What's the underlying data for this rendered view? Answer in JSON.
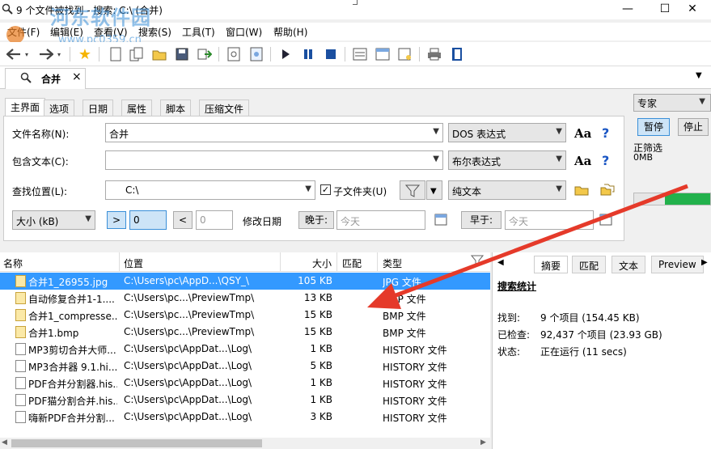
{
  "window": {
    "title": "9 个文件被找到 - 搜索: C:\\ (合并)",
    "min": "—",
    "restore": "☐",
    "close": "✕"
  },
  "watermark": {
    "line1": "河东软件园",
    "line2": "www.pc0359.cn"
  },
  "menu": [
    "文件(F)",
    "编辑(E)",
    "查看(V)",
    "搜索(S)",
    "工具(T)",
    "窗口(W)",
    "帮助(H)"
  ],
  "search_tab": {
    "label": "合并",
    "close": "×"
  },
  "panel_tabs": [
    "主界面",
    "选项",
    "日期",
    "属性",
    "脚本",
    "压缩文件"
  ],
  "form": {
    "filename_label": "文件名称(N):",
    "filename_value": "合并",
    "filename_mode": "DOS 表达式",
    "contains_label": "包含文本(C):",
    "contains_value": "",
    "contains_mode": "布尔表达式",
    "location_label": "查找位置(L):",
    "location_value": "C:\\",
    "subfolders_label": "子文件夹(U)",
    "subfolders_checked": true,
    "location_mode": "纯文本",
    "size_label": "大小 (kB)",
    "gt": ">",
    "gt_value": "0",
    "lt": "<",
    "lt_value": "0",
    "mod_date_label": "修改日期",
    "later_btn": "晚于:",
    "later_value": "今天",
    "earlier_btn": "早于:",
    "earlier_value": "今天",
    "aa": "Aa",
    "help": "?"
  },
  "right_panel": {
    "mode": "专家",
    "pause": "暂停",
    "stop": "停止",
    "status": "正筛选",
    "size": "0MB",
    "progress": 0.6
  },
  "list": {
    "headers": {
      "name": "名称",
      "location": "位置",
      "size": "大小",
      "match": "匹配",
      "type": "类型"
    },
    "rows": [
      {
        "name": "合并1_26955.jpg",
        "loc": "C:\\Users\\pc\\AppD...\\QSY_\\",
        "size": "105 KB",
        "type": "JPG 文件",
        "icon": "image-file-icon",
        "selected": true
      },
      {
        "name": "自动修复合并1-1....",
        "loc": "C:\\Users\\pc...\\PreviewTmp\\",
        "size": "13 KB",
        "type": "BMP 文件",
        "icon": "image-file-icon",
        "selected": false
      },
      {
        "name": "合并1_compresse...",
        "loc": "C:\\Users\\pc...\\PreviewTmp\\",
        "size": "15 KB",
        "type": "BMP 文件",
        "icon": "image-file-icon",
        "selected": false
      },
      {
        "name": "合并1.bmp",
        "loc": "C:\\Users\\pc...\\PreviewTmp\\",
        "size": "15 KB",
        "type": "BMP 文件",
        "icon": "image-file-icon",
        "selected": false
      },
      {
        "name": "MP3剪切合并大师...",
        "loc": "C:\\Users\\pc\\AppDat...\\Log\\",
        "size": "1 KB",
        "type": "HISTORY 文件",
        "icon": "file-icon",
        "selected": false
      },
      {
        "name": "MP3合并器 9.1.hi...",
        "loc": "C:\\Users\\pc\\AppDat...\\Log\\",
        "size": "5 KB",
        "type": "HISTORY 文件",
        "icon": "file-icon",
        "selected": false
      },
      {
        "name": "PDF合并分割器.his...",
        "loc": "C:\\Users\\pc\\AppDat...\\Log\\",
        "size": "1 KB",
        "type": "HISTORY 文件",
        "icon": "file-icon",
        "selected": false
      },
      {
        "name": "PDF猫分割合并.his...",
        "loc": "C:\\Users\\pc\\AppDat...\\Log\\",
        "size": "1 KB",
        "type": "HISTORY 文件",
        "icon": "file-icon",
        "selected": false
      },
      {
        "name": "嗨新PDF合并分割...",
        "loc": "C:\\Users\\pc\\AppDat...\\Log\\",
        "size": "3 KB",
        "type": "HISTORY 文件",
        "icon": "file-icon",
        "selected": false
      }
    ]
  },
  "stats": {
    "tabs": [
      "摘要",
      "匹配",
      "文本",
      "Preview"
    ],
    "heading": "搜索统计",
    "found_label": "找到:",
    "found_value": "9 个项目 (154.45 KB)",
    "checked_label": "已检查:",
    "checked_value": "92,437 个项目 (23.93 GB)",
    "state_label": "状态:",
    "state_value": "正在运行 (11 secs)"
  },
  "colors": {
    "selection": "#3399ff",
    "progress": "#22b14c",
    "arrow": "#e53a2a"
  }
}
